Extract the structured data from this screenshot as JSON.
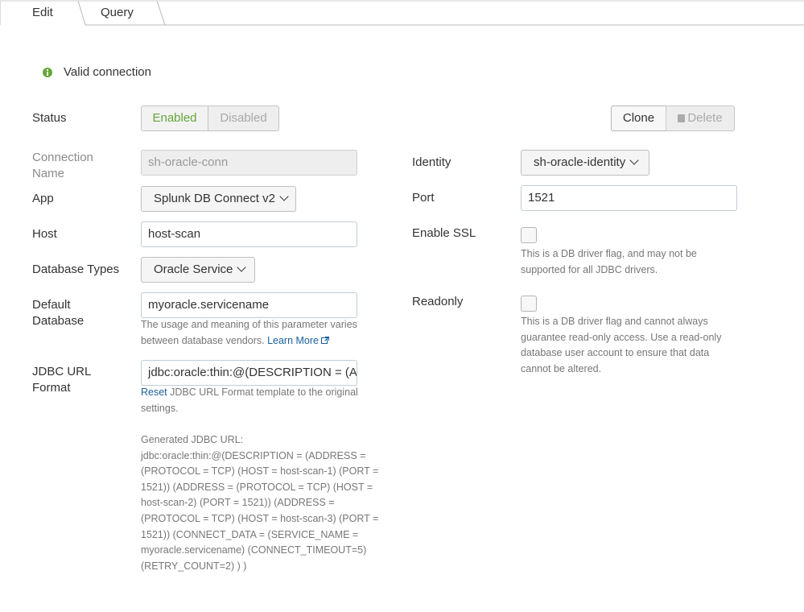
{
  "tabs": [
    {
      "label": "Edit"
    },
    {
      "label": "Query"
    }
  ],
  "status_message": "Valid connection",
  "form": {
    "status": {
      "label": "Status",
      "enabled": "Enabled",
      "disabled": "Disabled",
      "selected": "Enabled"
    },
    "clone_label": "Clone",
    "delete_label": "Delete",
    "connection_name": {
      "label_line1": "Connection",
      "label_line2": "Name",
      "value": "sh-oracle-conn"
    },
    "app": {
      "label": "App",
      "value": "Splunk DB Connect v2"
    },
    "host": {
      "label": "Host",
      "value": "host-scan"
    },
    "database_types": {
      "label": "Database Types",
      "value": "Oracle Service"
    },
    "default_database": {
      "label_line1": "Default",
      "label_line2": "Database",
      "value": "myoracle.servicename",
      "help_line1": "The usage and meaning of this parameter varies",
      "help_line2_prefix": "between database vendors.",
      "learn_more": "Learn More"
    },
    "jdbc_url_format": {
      "label_line1": "JDBC URL",
      "label_line2": "Format",
      "value": "jdbc:oracle:thin:@(DESCRIPTION = (ADDRESS = (PROTOCOL = TCP)",
      "reset": "Reset",
      "help_line1_suffix": "JDBC URL Format template to the original",
      "help_line2": "settings.",
      "generated_lines": [
        "Generated JDBC URL:",
        "jdbc:oracle:thin:@(DESCRIPTION = (ADDRESS =",
        "(PROTOCOL = TCP) (HOST = host-scan-1) (PORT =",
        "1521)) (ADDRESS = (PROTOCOL = TCP) (HOST =",
        "host-scan-2) (PORT = 1521)) (ADDRESS =",
        "(PROTOCOL = TCP) (HOST = host-scan-3) (PORT =",
        "1521)) (CONNECT_DATA = (SERVICE_NAME =",
        "myoracle.servicename) (CONNECT_TIMEOUT=5)",
        "(RETRY_COUNT=2) ) )"
      ]
    },
    "identity": {
      "label": "Identity",
      "value": "sh-oracle-identity"
    },
    "port": {
      "label": "Port",
      "value": "1521"
    },
    "enable_ssl": {
      "label": "Enable SSL",
      "checked": false,
      "help_line1": "This is a DB driver flag, and may not be",
      "help_line2": "supported for all JDBC drivers."
    },
    "readonly": {
      "label": "Readonly",
      "checked": false,
      "help_lines": [
        "This is a DB driver flag and cannot always",
        "guarantee read-only access. Use a read-only",
        "database user account to ensure that data",
        "cannot be altered."
      ]
    }
  },
  "colors": {
    "success": "#65a637",
    "link": "#1a5f9e"
  }
}
